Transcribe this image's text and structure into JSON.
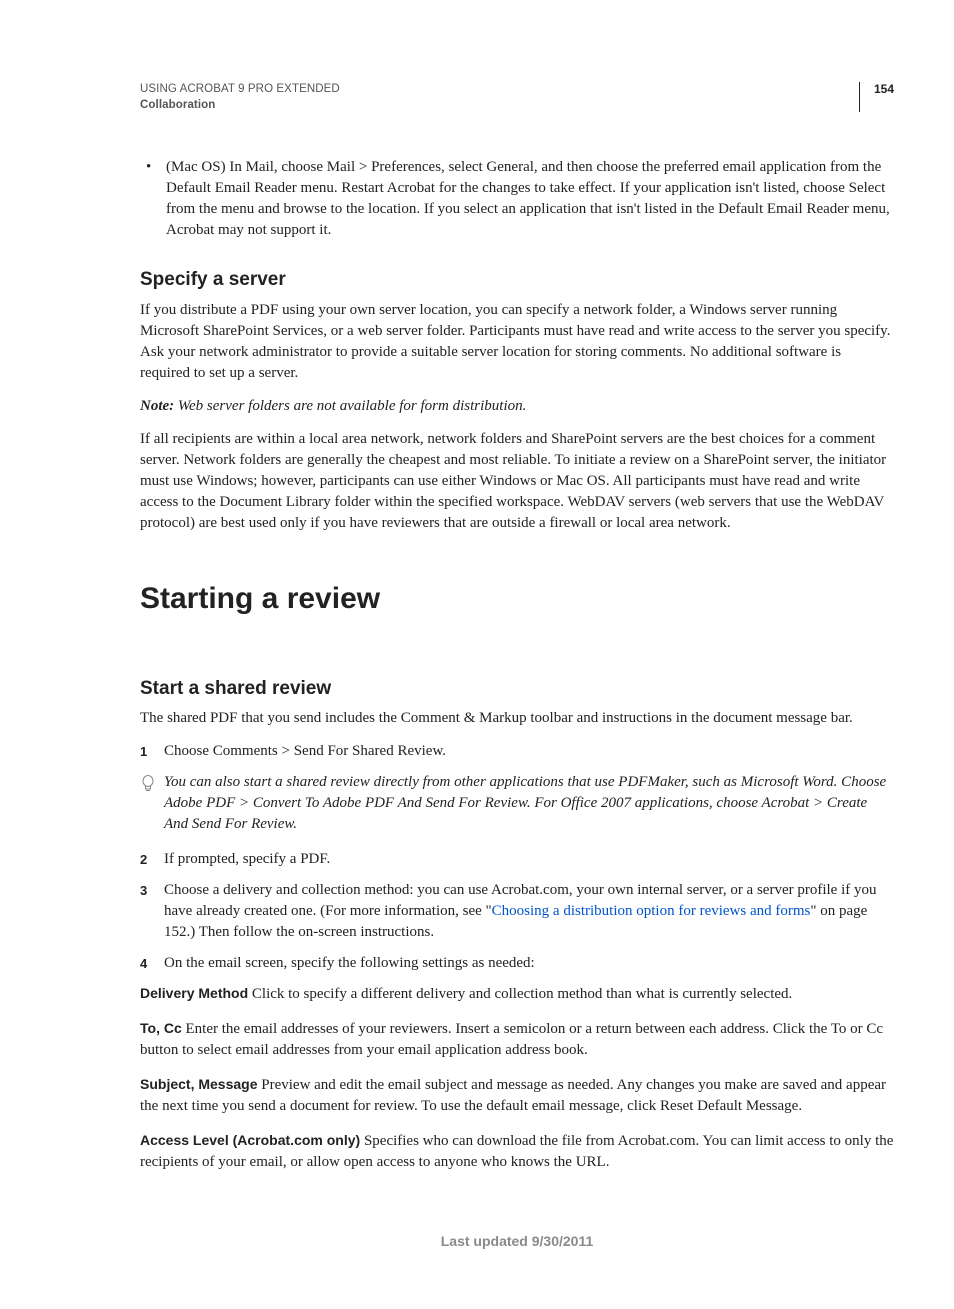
{
  "header": {
    "doc_title": "USING ACROBAT 9 PRO EXTENDED",
    "section": "Collaboration",
    "page_number": "154"
  },
  "bullet_macos": "(Mac OS) In Mail, choose Mail > Preferences, select General, and then choose the preferred email application from the Default Email Reader menu. Restart Acrobat for the changes to take effect. If your application isn't listed, choose Select from the menu and browse to the location. If you select an application that isn't listed in the Default Email Reader menu, Acrobat may not support it.",
  "specify_server": {
    "heading": "Specify a server",
    "para1": "If you distribute a PDF using your own server location, you can specify a network folder, a Windows server running Microsoft SharePoint Services, or a web server folder. Participants must have read and write access to the server you specify. Ask your network administrator to provide a suitable server location for storing comments. No additional software is required to set up a server.",
    "note_label": "Note:",
    "note_text": " Web server folders are not available for form distribution.",
    "para2": "If all recipients are within a local area network, network folders and SharePoint servers are the best choices for a comment server. Network folders are generally the cheapest and most reliable. To initiate a review on a SharePoint server, the initiator must use Windows; however, participants can use either Windows or Mac OS. All participants must have read and write access to the Document Library folder within the specified workspace. WebDAV servers (web servers that use the WebDAV protocol) are best used only if you have reviewers that are outside a firewall or local area network."
  },
  "starting_review": {
    "heading": "Starting a review"
  },
  "shared_review": {
    "heading": "Start a shared review",
    "intro": "The shared PDF that you send includes the Comment & Markup toolbar and instructions in the document message bar.",
    "step1_num": "1",
    "step1": "Choose Comments > Send For Shared Review.",
    "tip": "You can also start a shared review directly from other applications that use PDFMaker, such as Microsoft Word. Choose Adobe PDF > Convert To Adobe PDF And Send For Review. For Office 2007 applications, choose Acrobat > Create And Send For Review.",
    "step2_num": "2",
    "step2": "If prompted, specify a PDF.",
    "step3_num": "3",
    "step3_pre": "Choose a delivery and collection method: you can use Acrobat.com, your own internal server, or a server profile if you have already created one. (For more information, see \"",
    "step3_link": "Choosing a distribution option for reviews and forms",
    "step3_post": "\" on page 152.) Then follow the on-screen instructions.",
    "step4_num": "4",
    "step4": "On the email screen, specify the following settings as needed:",
    "defs": {
      "delivery_term": "Delivery Method",
      "delivery_body": "  Click to specify a different delivery and collection method than what is currently selected.",
      "tocc_term": "To, Cc",
      "tocc_body": "  Enter the email addresses of your reviewers. Insert a semicolon or a return between each address. Click the To or Cc button to select email addresses from your email application address book.",
      "subject_term": "Subject, Message",
      "subject_body": "  Preview and edit the email subject and message as needed. Any changes you make are saved and appear the next time you send a document for review. To use the default email message, click Reset Default Message.",
      "access_term": "Access Level (Acrobat.com only)",
      "access_body": "  Specifies who can download the file from Acrobat.com. You can limit access to only the recipients of your email, or allow open access to anyone who knows the URL."
    }
  },
  "footer": "Last updated 9/30/2011"
}
